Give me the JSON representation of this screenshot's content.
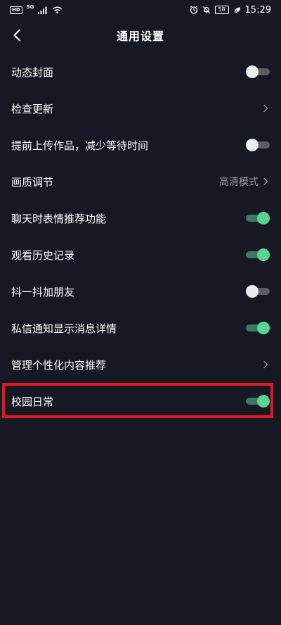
{
  "status_bar": {
    "hd": "HD",
    "network": "5G",
    "battery": "58",
    "time": "15:29"
  },
  "header": {
    "title": "通用设置"
  },
  "settings": [
    {
      "label": "动态封面",
      "control": "toggle",
      "on": false
    },
    {
      "label": "检查更新",
      "control": "chevron"
    },
    {
      "label": "提前上传作品，减少等待时间",
      "control": "toggle",
      "on": false
    },
    {
      "label": "画质调节",
      "control": "chevron",
      "value": "高清模式"
    },
    {
      "label": "聊天时表情推荐功能",
      "control": "toggle",
      "on": true
    },
    {
      "label": "观看历史记录",
      "control": "toggle",
      "on": true
    },
    {
      "label": "抖一抖加朋友",
      "control": "toggle",
      "on": false
    },
    {
      "label": "私信通知显示消息详情",
      "control": "toggle",
      "on": true
    },
    {
      "label": "管理个性化内容推荐",
      "control": "chevron"
    },
    {
      "label": "校园日常",
      "control": "toggle",
      "on": true,
      "highlighted": true
    }
  ],
  "colors": {
    "background": "#161823",
    "toggle_on_knob": "#58d392",
    "toggle_on_track": "#3b7a5f",
    "toggle_off_knob": "#ececec",
    "highlight_border": "#e8151f"
  }
}
